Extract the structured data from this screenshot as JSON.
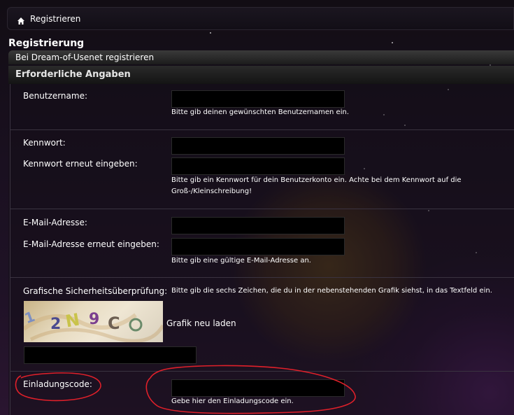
{
  "breadcrumb": {
    "home_label": "Registrieren"
  },
  "page_title": "Registrierung",
  "panel_title": "Bei Dream-of-Usenet registrieren",
  "section_title": "Erforderliche Angaben",
  "fields": {
    "username": {
      "label": "Benutzername:",
      "value": "",
      "hint": "Bitte gib deinen gewünschten Benutzernamen ein."
    },
    "password": {
      "label": "Kennwort:",
      "value": ""
    },
    "password_confirm": {
      "label": "Kennwort erneut eingeben:",
      "value": "",
      "hint": "Bitte gib ein Kennwort für dein Benutzerkonto ein. Achte bei dem Kennwort auf die Groß-/Kleinschreibung!"
    },
    "email": {
      "label": "E-Mail-Adresse:",
      "value": ""
    },
    "email_confirm": {
      "label": "E-Mail-Adresse erneut eingeben:",
      "value": "",
      "hint": "Bitte gib eine gültige E-Mail-Adresse an."
    },
    "captcha": {
      "label": "Grafische Sicherheitsüberprüfung:",
      "hint": "Bitte gib die sechs Zeichen, die du in der nebenstehenden Grafik siehst, in das Textfeld ein.",
      "reload_label": "Grafik neu laden",
      "value": ""
    },
    "invite": {
      "label": "Einladungscode:",
      "value": "",
      "hint": "Gebe hier den Einladungscode ein."
    }
  },
  "colors": {
    "annotation": "#e0202a",
    "input_bg": "#000000",
    "header_bg": "#2a2a2a"
  },
  "icons": {
    "home": "home-icon"
  }
}
